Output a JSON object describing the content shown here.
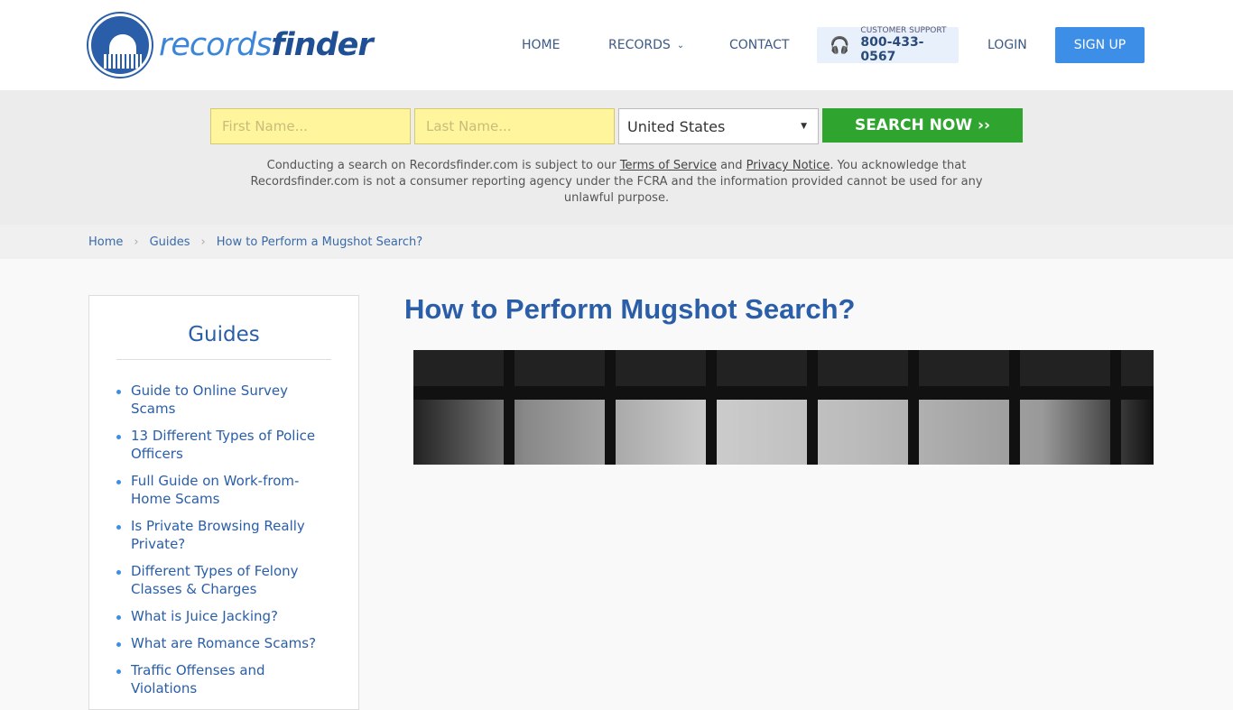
{
  "header": {
    "logo": "recordsfinder",
    "logo_a": "records",
    "logo_b": "finder",
    "nav": [
      {
        "label": "HOME"
      },
      {
        "label": "RECORDS"
      },
      {
        "label": "CONTACT"
      }
    ],
    "support": {
      "title": "CUSTOMER SUPPORT",
      "phone": "800-433-0567"
    },
    "login": "LOGIN",
    "signup": "SIGN UP"
  },
  "search": {
    "first_placeholder": "First Name...",
    "last_placeholder": "Last Name...",
    "country": "United States",
    "button": "SEARCH NOW ››",
    "disclaimer_1": "Conducting a search on Recordsfinder.com is subject to our ",
    "tos": "Terms of Service",
    "and": " and ",
    "privacy": "Privacy Notice",
    "disclaimer_2": ". You acknowledge that Recordsfinder.com is not a consumer reporting agency under the FCRA and the information provided cannot be used for any unlawful purpose."
  },
  "breadcrumb": [
    "Home",
    "Guides",
    "How to Perform a Mugshot Search?"
  ],
  "sidebar": {
    "title": "Guides",
    "items": [
      "Guide to Online Survey Scams",
      "13 Different Types of Police Officers",
      "Full Guide on Work-from-Home Scams",
      "Is Private Browsing Really Private?",
      "Different Types of Felony Classes & Charges",
      "What is Juice Jacking?",
      "What are Romance Scams?",
      "Traffic Offenses and Violations"
    ]
  },
  "main": {
    "title": "How to Perform Mugshot Search?"
  }
}
